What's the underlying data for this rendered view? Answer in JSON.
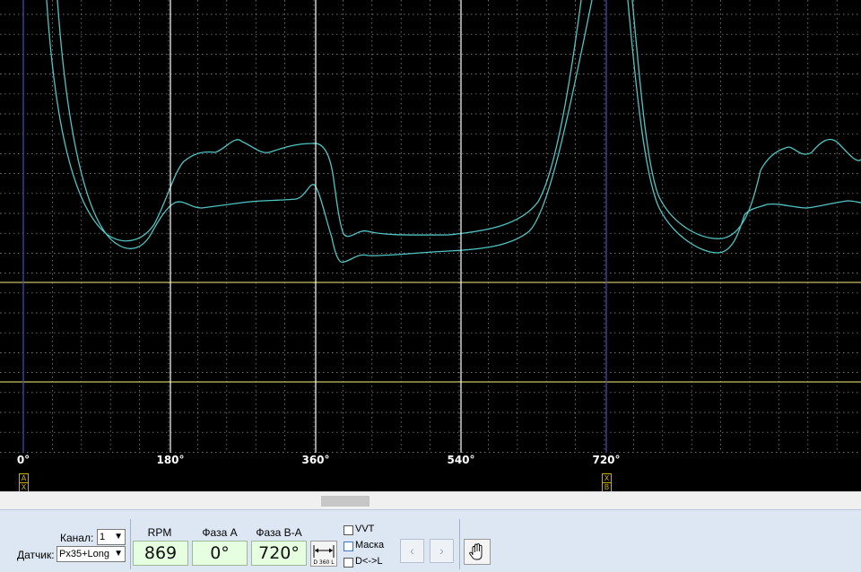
{
  "scope": {
    "degree_labels": [
      "0°",
      "180°",
      "360°",
      "540°",
      "720°"
    ],
    "marker_a": [
      "A",
      "X"
    ],
    "marker_b": [
      "X",
      "B"
    ],
    "colors": {
      "background": "#000000",
      "grid": "#9a9a9a",
      "trace": "#4fc4c4",
      "phase_line": "#ffffff",
      "cursor_line": "#4a4ab8",
      "level_line": "#c8c060"
    }
  },
  "panel": {
    "channel_label": "Канал:",
    "channel_value": "1",
    "sensor_label": "Датчик:",
    "sensor_value": "Px35+Long",
    "rpm_title": "RPM",
    "rpm_value": "869",
    "phase_a_title": "Фаза А",
    "phase_a_value": "0°",
    "phase_ba_title": "Фаза В-А",
    "phase_ba_value": "720°",
    "d360_label": "D 360 L",
    "vvt_label": "VVT",
    "mask_label": "Маска",
    "dl_label": "D<->L",
    "prev_icon": "‹",
    "next_icon": "›",
    "hand_icon": "hand-icon"
  }
}
